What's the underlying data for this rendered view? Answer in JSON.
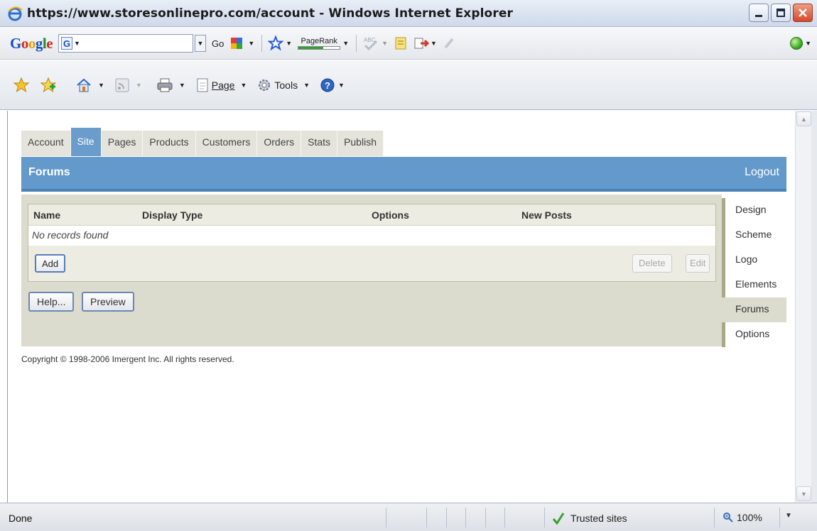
{
  "window": {
    "title": "https://www.storesonlinepro.com/account - Windows Internet Explorer"
  },
  "google_toolbar": {
    "logo": "Google",
    "go_label": "Go",
    "pagerank_label": "PageRank"
  },
  "command_bar": {
    "page_label": "Page",
    "tools_label": "Tools"
  },
  "tabs": [
    {
      "label": "Account"
    },
    {
      "label": "Site"
    },
    {
      "label": "Pages"
    },
    {
      "label": "Products"
    },
    {
      "label": "Customers"
    },
    {
      "label": "Orders"
    },
    {
      "label": "Stats"
    },
    {
      "label": "Publish"
    }
  ],
  "header": {
    "title": "Forums",
    "logout": "Logout"
  },
  "grid": {
    "columns": [
      "Name",
      "Display Type",
      "Options",
      "New Posts"
    ],
    "empty_text": "No records found",
    "add_label": "Add",
    "delete_label": "Delete",
    "edit_label": "Edit"
  },
  "footer_buttons": {
    "help_label": "Help...",
    "preview_label": "Preview"
  },
  "side_nav": [
    {
      "label": "Design"
    },
    {
      "label": "Scheme"
    },
    {
      "label": "Logo"
    },
    {
      "label": "Elements"
    },
    {
      "label": "Forums"
    },
    {
      "label": "Options"
    }
  ],
  "copyright": "Copyright © 1998-2006 Imergent Inc. All rights reserved.",
  "status_bar": {
    "status": "Done",
    "zone": "Trusted sites",
    "zoom": "100%"
  },
  "colors": {
    "header_blue": "#6499cb",
    "panel_beige": "#dcdcce",
    "tab_inactive": "#e4e4dc"
  }
}
